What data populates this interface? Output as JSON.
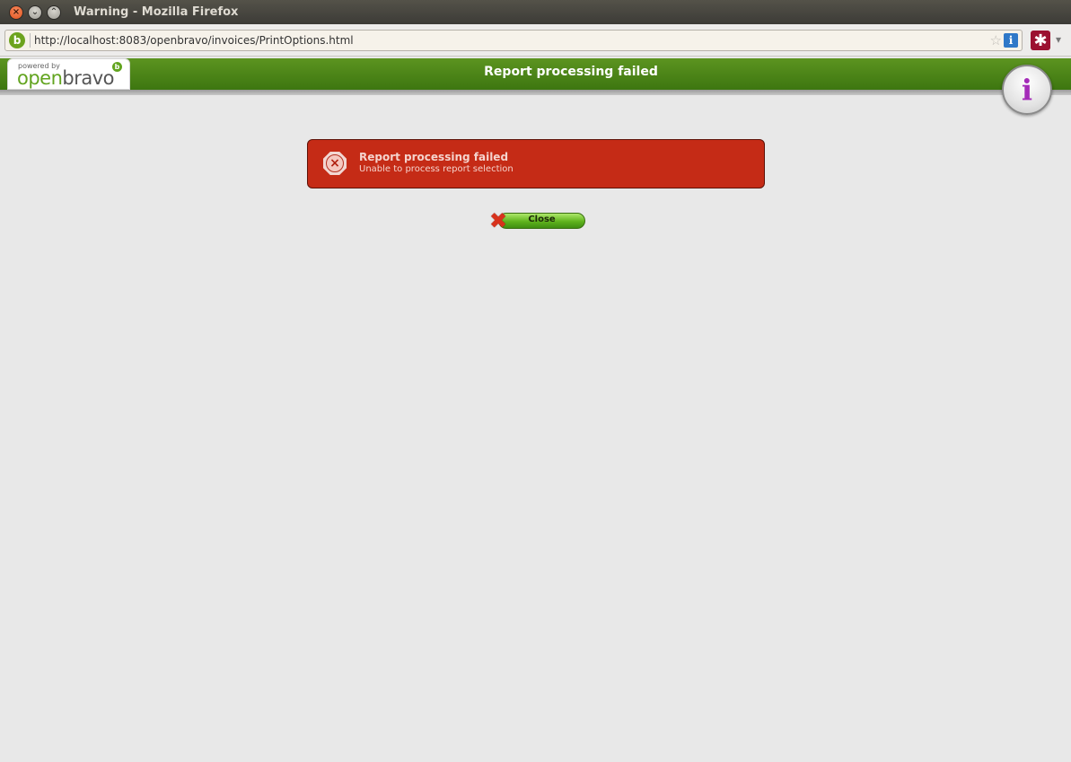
{
  "window": {
    "title": "Warning - Mozilla Firefox",
    "controls": {
      "close": "×",
      "minimize": "⌄",
      "maximize": "⌃"
    }
  },
  "navbar": {
    "site_icon_letter": "b",
    "url": "http://localhost:8083/openbravo/invoices/PrintOptions.html",
    "bookmark_star": "☆",
    "info_glyph": "i",
    "addon_glyph": "✱",
    "addon_dropdown": "▾"
  },
  "header": {
    "logo": {
      "powered_by": "powered by",
      "brand_prefix": "open",
      "brand_suffix": "bravo",
      "mark": "b"
    },
    "title": "Report processing failed",
    "info_glyph": "i"
  },
  "error": {
    "title": "Report processing failed",
    "message": "Unable to process report selection",
    "icon_glyph": "×"
  },
  "close_button": {
    "label": "Close",
    "icon_glyph": "✖"
  },
  "colors": {
    "header_green": "#4a8516",
    "error_red": "#c52b16",
    "button_green": "#5fb31d",
    "info_purple": "#a42bb8"
  }
}
